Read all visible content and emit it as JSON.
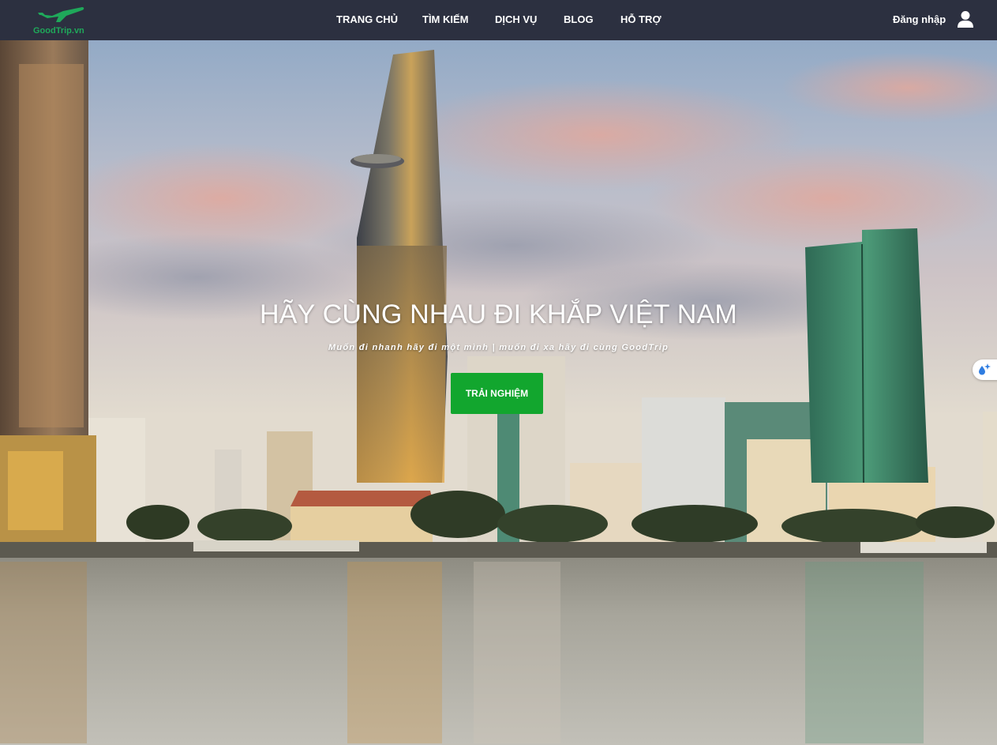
{
  "brand": {
    "logo_text": "GoodTrip.vn",
    "color": "#1fa85a"
  },
  "nav": {
    "items": [
      {
        "label": "TRANG CHỦ"
      },
      {
        "label": "TÌM KIẾM"
      },
      {
        "label": "DỊCH VỤ"
      },
      {
        "label": "BLOG"
      },
      {
        "label": "HỖ TRỢ"
      }
    ],
    "login_label": "Đăng nhập",
    "background": "#2c3040"
  },
  "hero": {
    "title": "HÃY CÙNG NHAU ĐI KHẮP VIỆT NAM",
    "subtitle": "Muốn đi nhanh hãy đi một mình | muốn đi xa hãy đi cùng GoodTrip",
    "cta_label": "TRẢI NGHIỆM",
    "cta_color": "#12a62e"
  },
  "icons": {
    "logo": "airplane-icon",
    "user": "user-icon",
    "widget": "sparkle-drop-icon"
  }
}
